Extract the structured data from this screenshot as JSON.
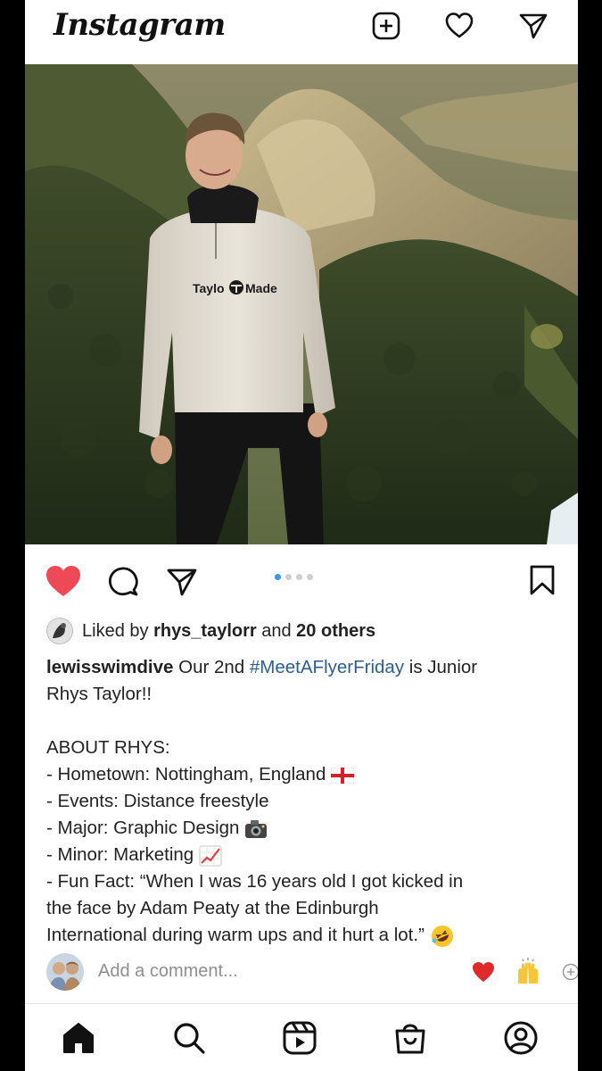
{
  "header": {
    "brand": "Instagram",
    "icons": [
      "new-post-icon",
      "heart-icon",
      "direct-message-icon"
    ]
  },
  "post": {
    "photo": {
      "subject": "Young man in grey quarter-zip sweatshirt standing in front of rocky, tree-covered hillside",
      "sweatshirt_logo": "TaylorMade"
    },
    "carousel": {
      "total": 4,
      "active_index": 0
    },
    "liked_by": {
      "prefix": "Liked by ",
      "user": "rhys_taylorr",
      "joiner": " and ",
      "others": "20 others"
    },
    "caption": {
      "username": "lewisswimdive",
      "text_before_tag": " Our 2nd ",
      "hashtag": "#MeetAFlyerFriday",
      "text_after_tag": " is Junior",
      "line2": "Rhys Taylor!!",
      "about_heading": "ABOUT RHYS:",
      "hometown": "- Hometown: Nottingham, England",
      "events": "- Events: Distance freestyle",
      "major": "- Major: Graphic Design",
      "minor": "- Minor: Marketing",
      "fun_fact_1": "- Fun Fact: “When I was 16 years old I got kicked in",
      "fun_fact_2": "the face by Adam Peaty at the Edinburgh",
      "fun_fact_3": "International during warm ups and it hurt a lot.”"
    },
    "comment_placeholder": "Add a comment..."
  },
  "colors": {
    "liked_heart": "#ed4956",
    "hashtag": "#2b5e8f",
    "active_dot": "#3897f0"
  },
  "bottom_nav": [
    "home-icon",
    "search-icon",
    "reels-icon",
    "shop-icon",
    "profile-icon"
  ]
}
